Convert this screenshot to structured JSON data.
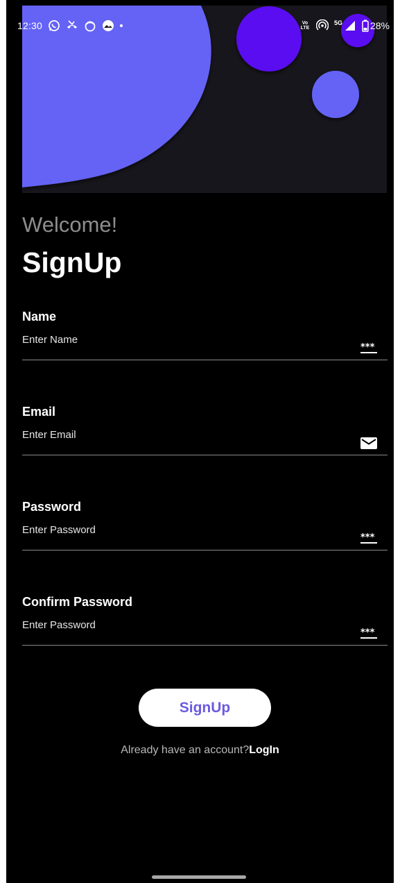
{
  "status_bar": {
    "time": "12:30",
    "volte_label": "Vo LTE",
    "network_label": "5G",
    "battery": "28%",
    "icons": [
      "whatsapp-icon",
      "missed-call-icon",
      "app-icon",
      "weather-icon",
      "dot-icon",
      "hotspot-icon",
      "signal-icon",
      "battery-icon"
    ]
  },
  "header": {
    "welcome": "Welcome!",
    "title": "SignUp"
  },
  "form": {
    "fields": [
      {
        "label": "Name",
        "placeholder": "Enter Name",
        "value": "",
        "icon": "password-dots-icon"
      },
      {
        "label": "Email",
        "placeholder": "Enter Email",
        "value": "",
        "icon": "mail-icon"
      },
      {
        "label": "Password",
        "placeholder": "Enter Password",
        "value": "",
        "icon": "password-dots-icon"
      },
      {
        "label": "Confirm Password",
        "placeholder": "Enter Password",
        "value": "",
        "icon": "password-dots-icon"
      }
    ]
  },
  "actions": {
    "signup_label": "SignUp",
    "login_prompt": "Already have an account?",
    "login_link": "LogIn"
  },
  "colors": {
    "background": "#000000",
    "accent": "#6a5cdf",
    "hero_blob": "#6563f5",
    "hero_circle": "#5a0df0"
  }
}
